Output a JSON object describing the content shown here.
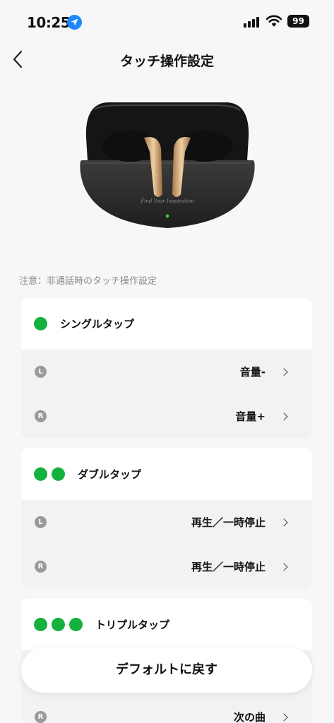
{
  "status_bar": {
    "time": "10:25",
    "battery": "99"
  },
  "header": {
    "title": "タッチ操作設定"
  },
  "note": "注意：非通話時のタッチ操作設定",
  "product": {
    "case_engraving": "Find Your Inspiration"
  },
  "sections": [
    {
      "title": "シングルタップ",
      "dots": 1,
      "rows": [
        {
          "side": "L",
          "value": "音量-"
        },
        {
          "side": "R",
          "value": "音量+"
        }
      ]
    },
    {
      "title": "ダブルタップ",
      "dots": 2,
      "rows": [
        {
          "side": "L",
          "value": "再生／一時停止"
        },
        {
          "side": "R",
          "value": "再生／一時停止"
        }
      ]
    },
    {
      "title": "トリプルタップ",
      "dots": 3,
      "rows": [
        {
          "side": "R",
          "value": "次の曲"
        }
      ]
    }
  ],
  "reset_button": "デフォルトに戻す",
  "colors": {
    "accent": "#14b13d",
    "location": "#1e88ff"
  }
}
